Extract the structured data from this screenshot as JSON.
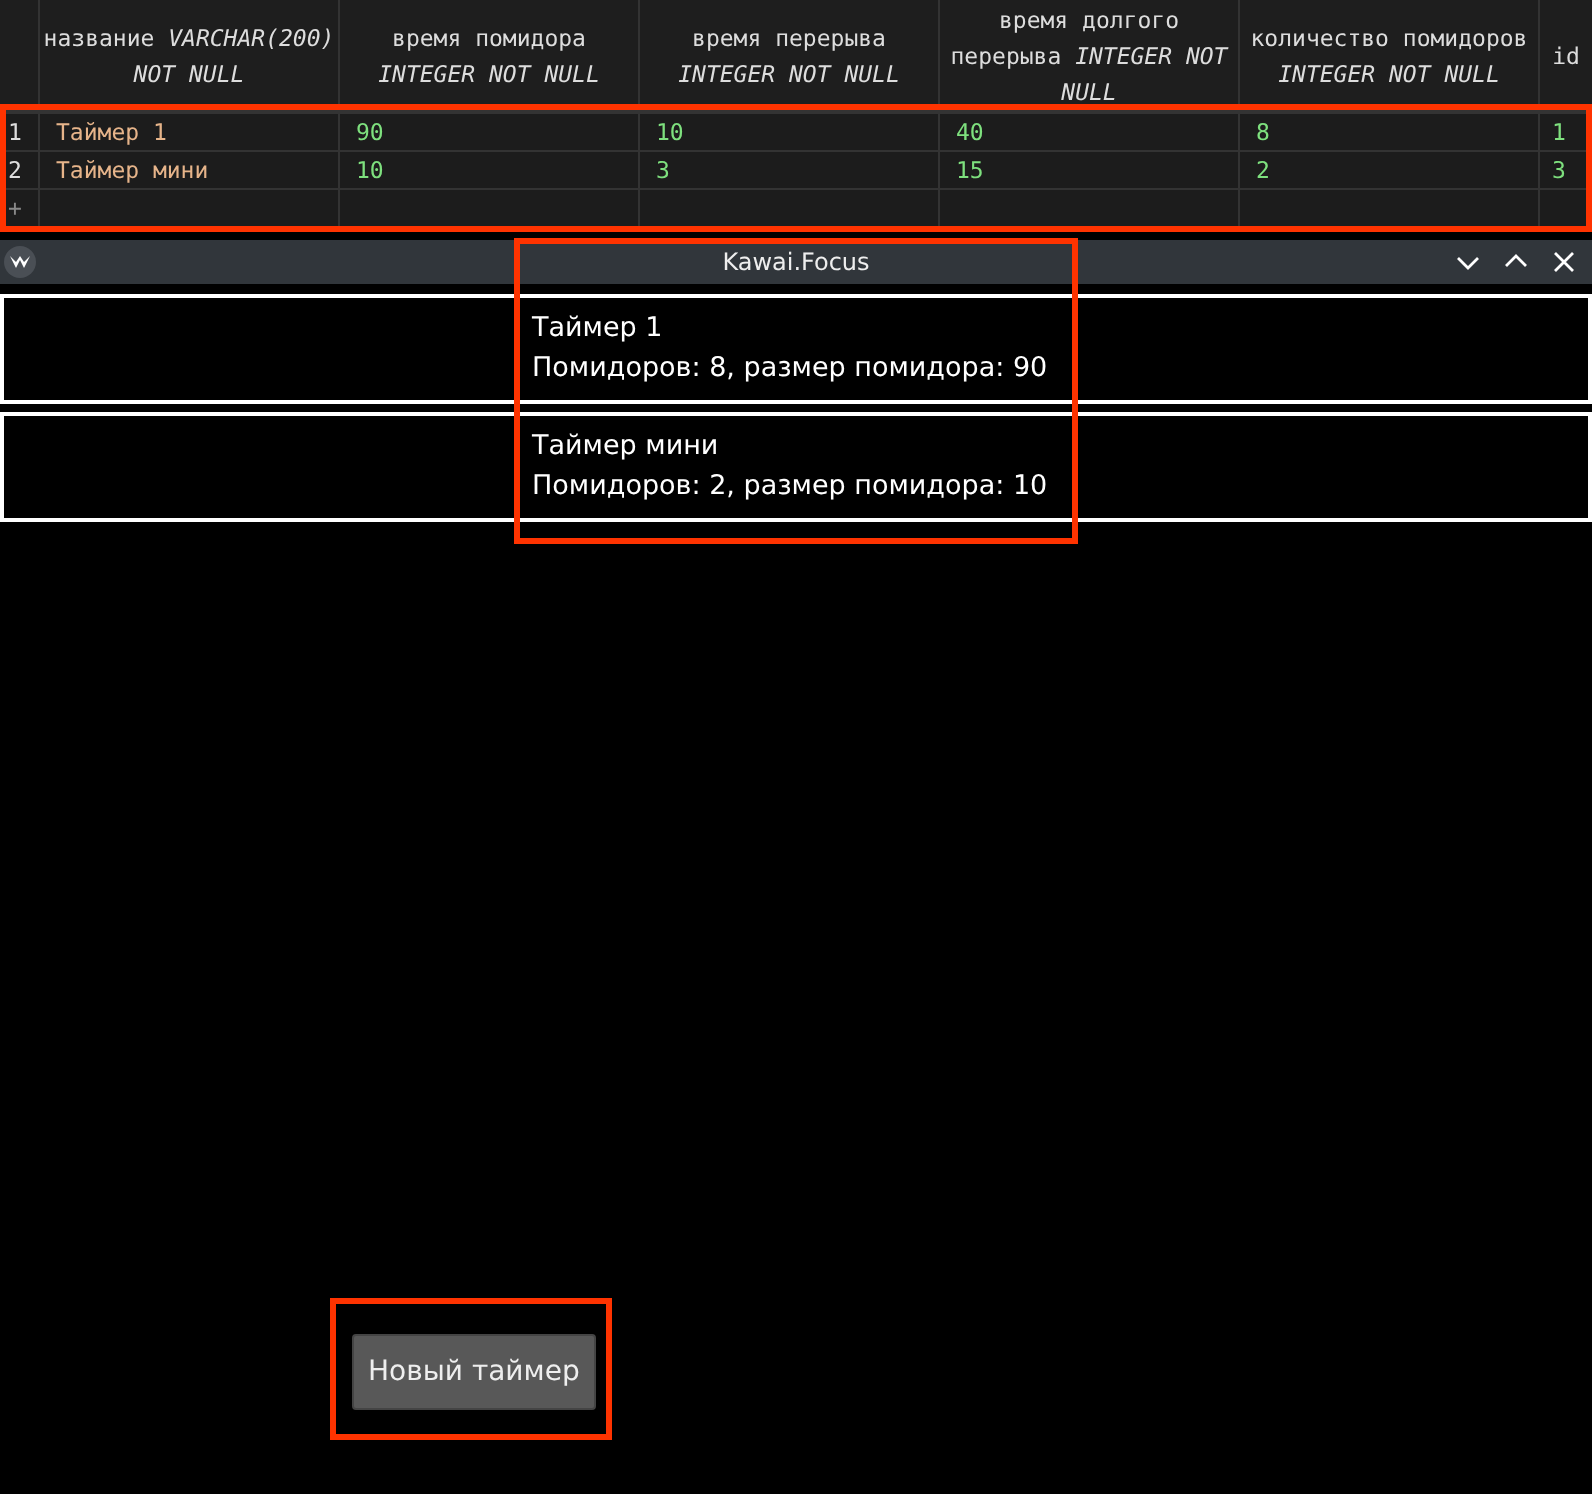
{
  "table": {
    "columns": [
      {
        "header": "название *VARCHAR(200) NOT NULL*",
        "kind": "text"
      },
      {
        "header": "время помидора *INTEGER NOT NULL*",
        "kind": "number"
      },
      {
        "header": "время перерыва *INTEGER NOT NULL*",
        "kind": "number"
      },
      {
        "header": "время долгого перерыва *INTEGER NOT NULL*",
        "kind": "number"
      },
      {
        "header": "количество помидоров *INTEGER NOT NULL*",
        "kind": "number"
      },
      {
        "header": "id",
        "kind": "number"
      }
    ],
    "rows": [
      {
        "number": "1",
        "cells": [
          "Таймер 1",
          "90",
          "10",
          "40",
          "8",
          "1"
        ]
      },
      {
        "number": "2",
        "cells": [
          "Таймер мини",
          "10",
          "3",
          "15",
          "2",
          "3"
        ]
      }
    ],
    "add_row": "+"
  },
  "window": {
    "title": "Kawai.Focus",
    "timers": [
      {
        "name": "Таймер 1",
        "details": "Помидоров: 8, размер помидора: 90"
      },
      {
        "name": "Таймер мини",
        "details": "Помидоров: 2, размер помидора: 10"
      }
    ],
    "new_button": "Новый таймер"
  }
}
